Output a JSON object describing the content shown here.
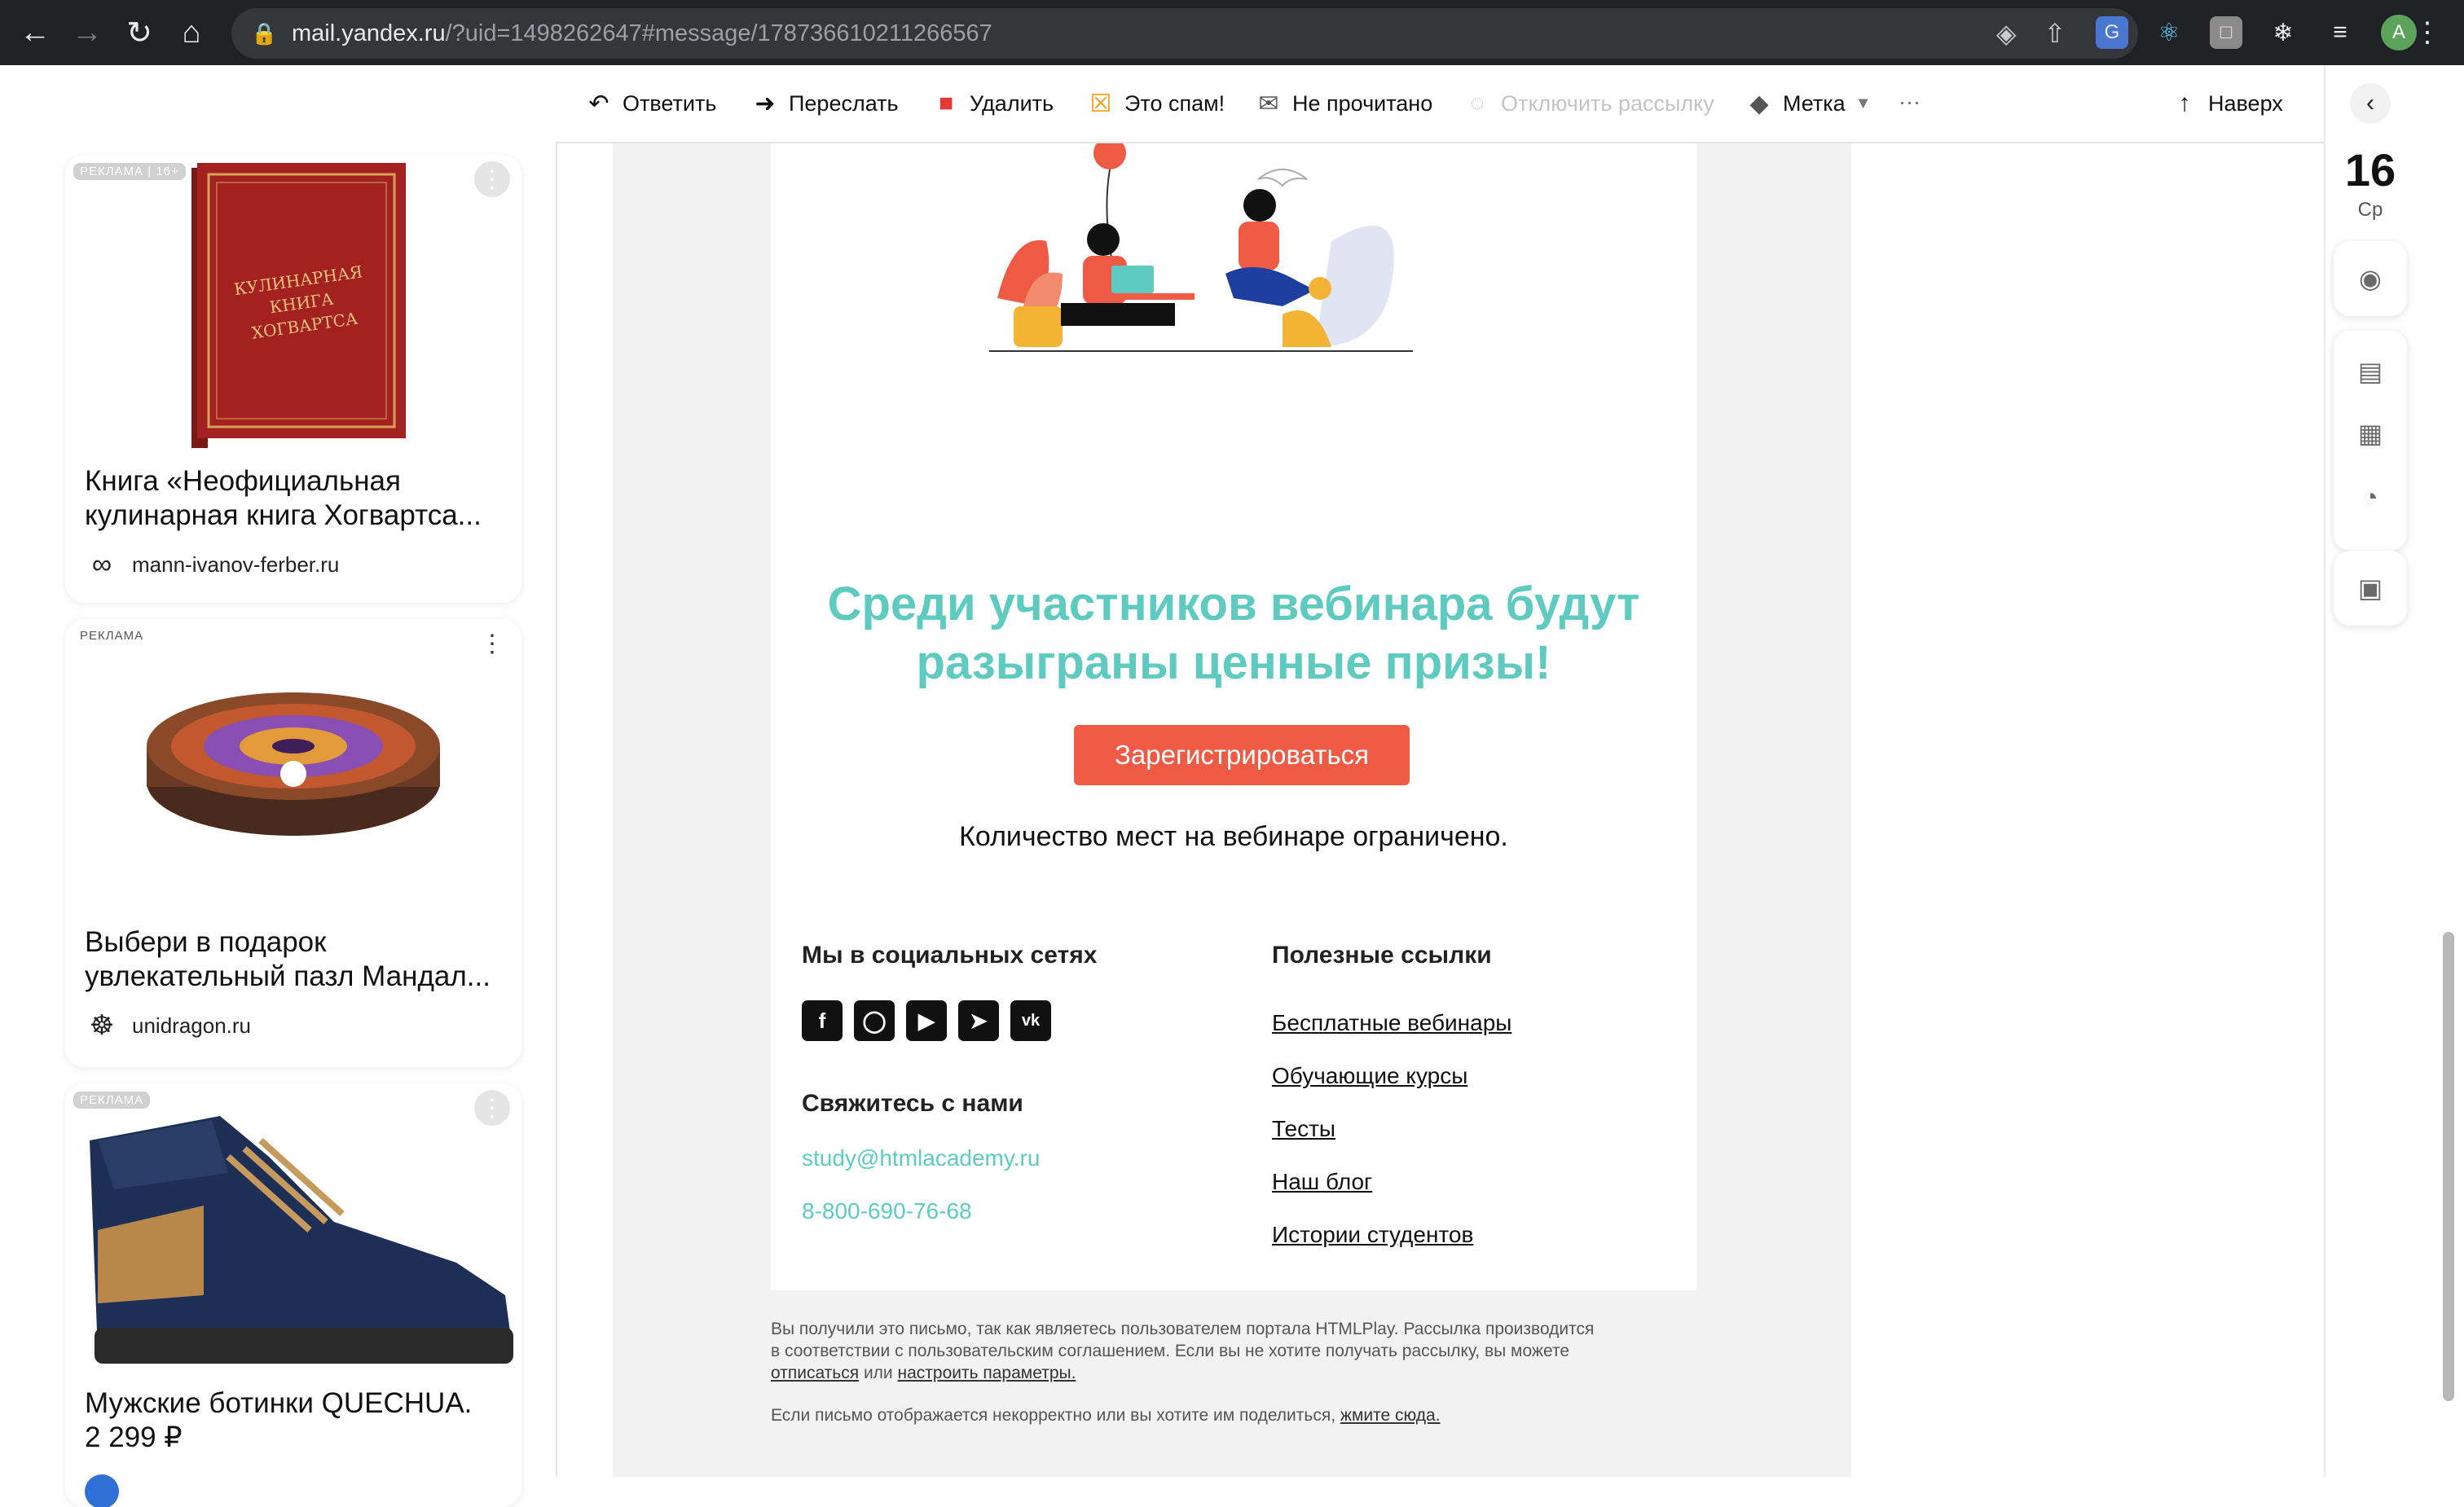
{
  "browser": {
    "url_host": "mail.yandex.ru",
    "url_path": "/?uid=1498262647#message/178736610211266567",
    "profile_initial": "A"
  },
  "ads": [
    {
      "tag": "РЕКЛАМА | 16+",
      "title_line1": "Книга «Неофициальная",
      "title_line2": "кулинарная книга Хогвартса...",
      "domain": "mann-ivanov-ferber.ru",
      "image_title_1": "КУЛИНАРНАЯ",
      "image_title_2": "КНИГА",
      "image_title_3": "ХОГВАРТСА"
    },
    {
      "tag": "РЕКЛАМА",
      "title_line1": "Выбери в подарок",
      "title_line2": "увлекательный пазл Мандал...",
      "domain": "unidragon.ru"
    },
    {
      "tag": "РЕКЛАМА",
      "title_line1": "Мужские ботинки QUECHUA.",
      "title_line2": "2 299 ₽"
    }
  ],
  "toolbar": {
    "reply": "Ответить",
    "forward": "Переслать",
    "delete": "Удалить",
    "spam": "Это спам!",
    "unread": "Не прочитано",
    "unsubscribe": "Отключить рассылку",
    "label": "Метка",
    "more": "···",
    "up": "Наверх"
  },
  "letter": {
    "promo_line1": "Среди участников вебинара будут",
    "promo_line2": "разыграны ценные призы!",
    "register_button": "Зарегистрироваться",
    "limited": "Количество мест на вебинаре ограничено.",
    "social_heading": "Мы в социальных сетях",
    "contact_heading": "Свяжитесь с нами",
    "email": "study@htmlacademy.ru",
    "phone": "8-800-690-76-68",
    "links_heading": "Полезные ссылки",
    "links": [
      "Бесплатные вебинары",
      "Обучающие курсы",
      "Тесты",
      "Наш блог",
      "Истории студентов"
    ],
    "footer_line1": "Вы получили это письмо, так как являетесь пользователем портала HTMLPlay. Рассылка производится",
    "footer_line2": "в соответствии с пользовательским соглашением. Если вы не хотите получать рассылку, вы можете",
    "footer_unsub": "отписаться",
    "footer_or": "или",
    "footer_settings": "настроить параметры.",
    "footer_share": "Если письмо отображается некорректно или вы хотите им поделиться,",
    "footer_share_link": "жмите сюда."
  },
  "rail": {
    "day": "16",
    "weekday": "Ср"
  },
  "colors": {
    "accent_teal": "#5fcbc0",
    "button_red": "#ee5a43"
  }
}
